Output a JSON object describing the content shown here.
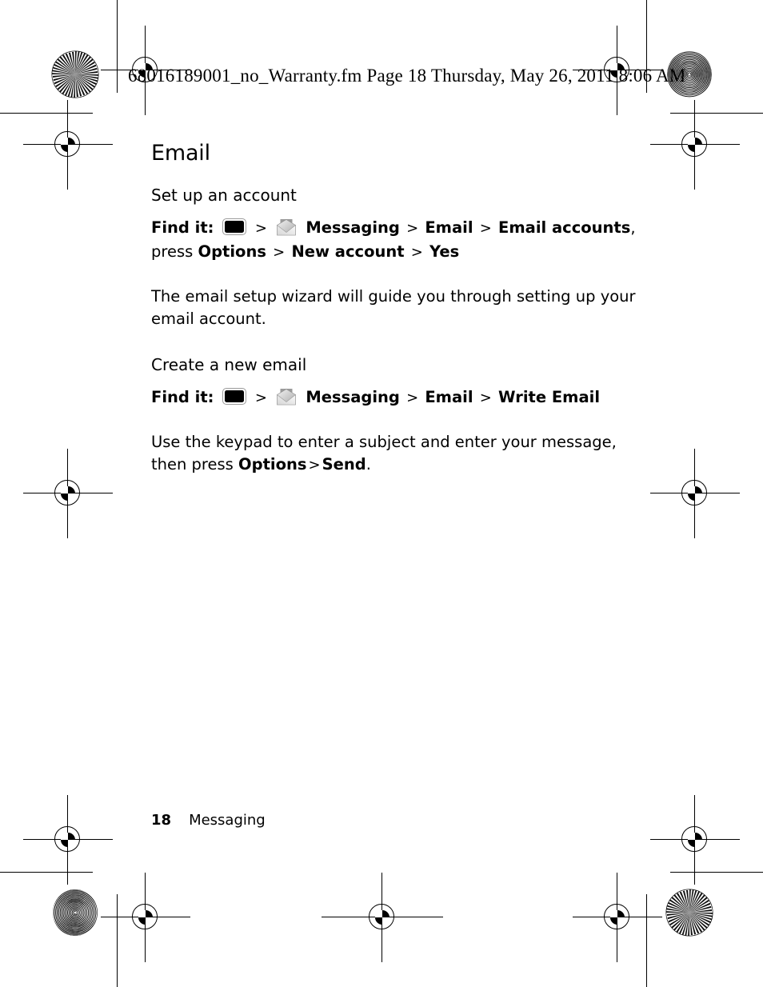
{
  "page_header": {
    "text": "68016189001_no_Warranty.fm  Page 18  Thursday, May 26, 2011  8:06 AM"
  },
  "content": {
    "title": "Email",
    "sections": [
      {
        "heading": "Set up an account",
        "find_it_label": "Find it:",
        "path": [
          "Messaging",
          "Email",
          "Email accounts"
        ],
        "path_tail_comma": ",",
        "press_label": "press",
        "press_path": [
          "Options",
          "New account",
          "Yes"
        ],
        "body": "The email setup wizard will guide you through setting up your email account."
      },
      {
        "heading": "Create a new email",
        "find_it_label": "Find it:",
        "path": [
          "Messaging",
          "Email",
          "Write Email"
        ],
        "body_pre": "Use the keypad to enter a subject and enter your message, then press ",
        "body_bold_1": "Options",
        "body_bold_2": "Send",
        "body_post": "."
      }
    ],
    "separator": ">",
    "icons": {
      "center_key": "center-select-key-icon",
      "messaging": "messaging-envelope-icon"
    }
  },
  "footer": {
    "page_number": "18",
    "section": "Messaging"
  },
  "print_marks": {
    "registration": "registration-target",
    "starburst": "starburst-resolution-patch",
    "moire": "moire-resolution-patch"
  },
  "colors": {
    "ink": "#000000",
    "paper": "#ffffff",
    "key_border": "#9a9a9a",
    "envelope_light": "#e6e6e6",
    "envelope_mid": "#bdbdbd",
    "envelope_dark": "#8c8c8c"
  }
}
